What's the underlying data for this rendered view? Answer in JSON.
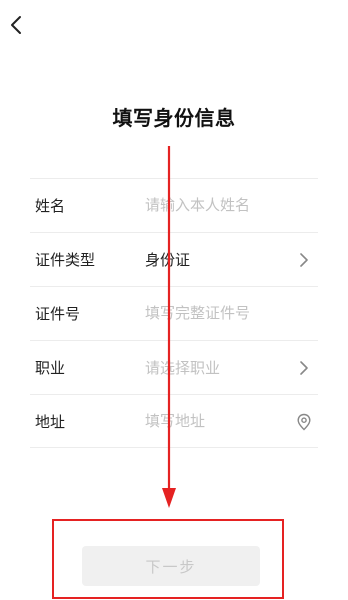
{
  "header": {
    "back_icon": "chevron-left-icon",
    "title": "填写身份信息"
  },
  "form": {
    "name": {
      "label": "姓名",
      "placeholder": "请输入本人姓名",
      "value": ""
    },
    "id_type": {
      "label": "证件类型",
      "value": "身份证",
      "trailing_icon": "chevron-right-icon"
    },
    "id_number": {
      "label": "证件号",
      "placeholder": "填写完整证件号",
      "value": ""
    },
    "occupation": {
      "label": "职业",
      "placeholder": "请选择职业",
      "trailing_icon": "chevron-right-icon"
    },
    "address": {
      "label": "地址",
      "placeholder": "填写地址",
      "value": "",
      "trailing_icon": "location-pin-icon"
    }
  },
  "footer": {
    "next_label": "下一步",
    "next_enabled": false
  },
  "annotation": {
    "color": "#e52222"
  }
}
